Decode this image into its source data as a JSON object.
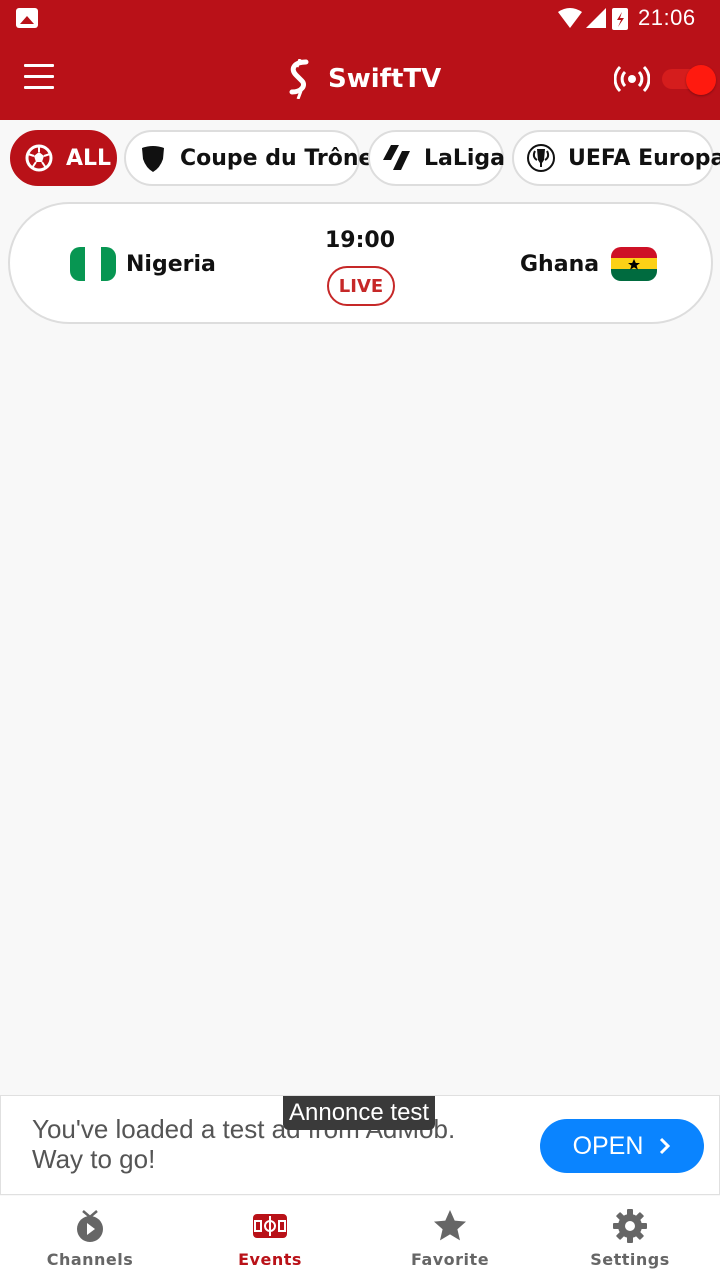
{
  "status_bar": {
    "time": "21:06"
  },
  "app_bar": {
    "title": "SwiftTV"
  },
  "chips": [
    {
      "label": "ALL",
      "icon": "soccer-ball-icon",
      "active": true
    },
    {
      "label": "Coupe du Trône",
      "icon": "shield-icon",
      "active": false
    },
    {
      "label": "LaLiga",
      "icon": "laliga-icon",
      "active": false
    },
    {
      "label": "UEFA Europa",
      "icon": "uefa-trophy-icon",
      "active": false
    }
  ],
  "match": {
    "home_team": "Nigeria",
    "away_team": "Ghana",
    "time": "19:00",
    "status": "LIVE"
  },
  "ad": {
    "tag": "Annonce test",
    "text": "You've loaded a test ad from AdMob. Way to go!",
    "button": "OPEN"
  },
  "bottom_nav": [
    {
      "label": "Channels",
      "icon": "tv-icon",
      "active": false
    },
    {
      "label": "Events",
      "icon": "stadium-icon",
      "active": true
    },
    {
      "label": "Favorite",
      "icon": "star-icon",
      "active": false
    },
    {
      "label": "Settings",
      "icon": "gear-icon",
      "active": false
    }
  ],
  "colors": {
    "primary": "#b91118",
    "live": "#c62828",
    "ad_button": "#0a84ff"
  }
}
